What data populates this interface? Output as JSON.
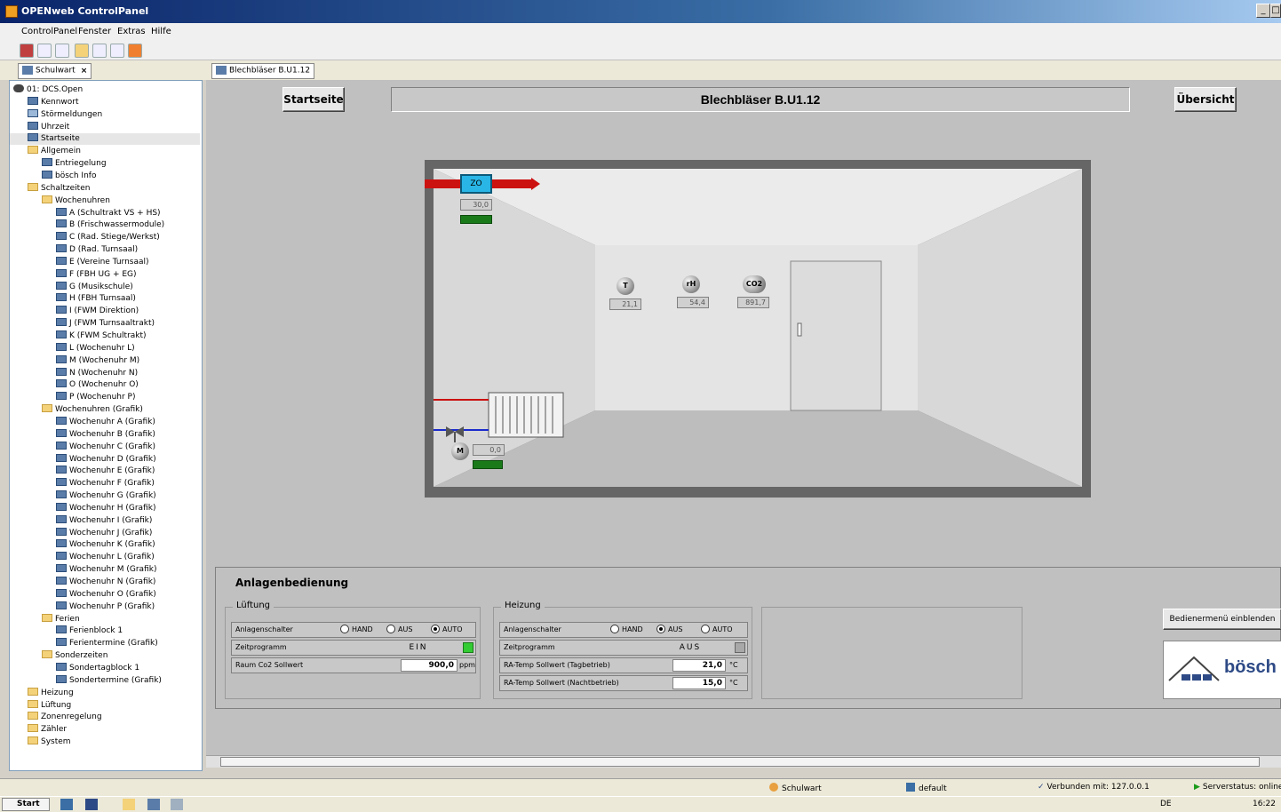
{
  "window": {
    "title": "OPENweb ControlPanel",
    "controls": [
      "_",
      "□"
    ]
  },
  "menubar": [
    "ControlPanel",
    "Fenster",
    "Extras",
    "Hilfe"
  ],
  "left_tab": {
    "label": "Schulwart"
  },
  "tree": [
    {
      "label": "01: DCS.Open",
      "level": 0,
      "icon": "root"
    },
    {
      "label": "Kennwort",
      "level": 1,
      "icon": "doc"
    },
    {
      "label": "Störmeldungen",
      "level": 1,
      "icon": "alarm"
    },
    {
      "label": "Uhrzeit",
      "level": 1,
      "icon": "doc"
    },
    {
      "label": "Startseite",
      "level": 1,
      "icon": "doc",
      "selected": true
    },
    {
      "label": "Allgemein",
      "level": 1,
      "icon": "folder"
    },
    {
      "label": "Entriegelung",
      "level": 2,
      "icon": "doc"
    },
    {
      "label": "bösch Info",
      "level": 2,
      "icon": "doc"
    },
    {
      "label": "Schaltzeiten",
      "level": 1,
      "icon": "folder"
    },
    {
      "label": "Wochenuhren",
      "level": 2,
      "icon": "folder"
    },
    {
      "label": "A (Schultrakt VS + HS)",
      "level": 3,
      "icon": "doc"
    },
    {
      "label": "B (Frischwassermodule)",
      "level": 3,
      "icon": "doc"
    },
    {
      "label": "C (Rad. Stiege/Werkst)",
      "level": 3,
      "icon": "doc"
    },
    {
      "label": "D (Rad. Turnsaal)",
      "level": 3,
      "icon": "doc"
    },
    {
      "label": "E (Vereine Turnsaal)",
      "level": 3,
      "icon": "doc"
    },
    {
      "label": "F (FBH UG + EG)",
      "level": 3,
      "icon": "doc"
    },
    {
      "label": "G (Musikschule)",
      "level": 3,
      "icon": "doc"
    },
    {
      "label": "H (FBH Turnsaal)",
      "level": 3,
      "icon": "doc"
    },
    {
      "label": "I (FWM Direktion)",
      "level": 3,
      "icon": "doc"
    },
    {
      "label": "J (FWM Turnsaaltrakt)",
      "level": 3,
      "icon": "doc"
    },
    {
      "label": "K (FWM Schultrakt)",
      "level": 3,
      "icon": "doc"
    },
    {
      "label": "L (Wochenuhr L)",
      "level": 3,
      "icon": "doc"
    },
    {
      "label": "M (Wochenuhr M)",
      "level": 3,
      "icon": "doc"
    },
    {
      "label": "N (Wochenuhr N)",
      "level": 3,
      "icon": "doc"
    },
    {
      "label": "O (Wochenuhr O)",
      "level": 3,
      "icon": "doc"
    },
    {
      "label": "P (Wochenuhr P)",
      "level": 3,
      "icon": "doc"
    },
    {
      "label": "Wochenuhren (Grafik)",
      "level": 2,
      "icon": "folder"
    },
    {
      "label": "Wochenuhr A (Grafik)",
      "level": 3,
      "icon": "doc"
    },
    {
      "label": "Wochenuhr B (Grafik)",
      "level": 3,
      "icon": "doc"
    },
    {
      "label": "Wochenuhr C (Grafik)",
      "level": 3,
      "icon": "doc"
    },
    {
      "label": "Wochenuhr D (Grafik)",
      "level": 3,
      "icon": "doc"
    },
    {
      "label": "Wochenuhr E (Grafik)",
      "level": 3,
      "icon": "doc"
    },
    {
      "label": "Wochenuhr F (Grafik)",
      "level": 3,
      "icon": "doc"
    },
    {
      "label": "Wochenuhr G (Grafik)",
      "level": 3,
      "icon": "doc"
    },
    {
      "label": "Wochenuhr H (Grafik)",
      "level": 3,
      "icon": "doc"
    },
    {
      "label": "Wochenuhr I (Grafik)",
      "level": 3,
      "icon": "doc"
    },
    {
      "label": "Wochenuhr J (Grafik)",
      "level": 3,
      "icon": "doc"
    },
    {
      "label": "Wochenuhr K (Grafik)",
      "level": 3,
      "icon": "doc"
    },
    {
      "label": "Wochenuhr L (Grafik)",
      "level": 3,
      "icon": "doc"
    },
    {
      "label": "Wochenuhr M (Grafik)",
      "level": 3,
      "icon": "doc"
    },
    {
      "label": "Wochenuhr N (Grafik)",
      "level": 3,
      "icon": "doc"
    },
    {
      "label": "Wochenuhr O (Grafik)",
      "level": 3,
      "icon": "doc"
    },
    {
      "label": "Wochenuhr P (Grafik)",
      "level": 3,
      "icon": "doc"
    },
    {
      "label": "Ferien",
      "level": 2,
      "icon": "folder"
    },
    {
      "label": "Ferienblock 1",
      "level": 3,
      "icon": "doc"
    },
    {
      "label": "Ferientermine (Grafik)",
      "level": 3,
      "icon": "doc"
    },
    {
      "label": "Sonderzeiten",
      "level": 2,
      "icon": "folder"
    },
    {
      "label": "Sondertagblock 1",
      "level": 3,
      "icon": "doc"
    },
    {
      "label": "Sondertermine (Grafik)",
      "level": 3,
      "icon": "doc"
    },
    {
      "label": "Heizung",
      "level": 1,
      "icon": "folder"
    },
    {
      "label": "Lüftung",
      "level": 1,
      "icon": "folder"
    },
    {
      "label": "Zonenregelung",
      "level": 1,
      "icon": "folder"
    },
    {
      "label": "Zähler",
      "level": 1,
      "icon": "folder"
    },
    {
      "label": "System",
      "level": 1,
      "icon": "folder"
    }
  ],
  "right_tab": {
    "label": "Blechbläser B.U1.12"
  },
  "header": {
    "start_button": "Startseite",
    "title": "Blechbläser B.U1.12",
    "overview_button": "Übersicht"
  },
  "room": {
    "fan_label": "ZO",
    "supply_value": "30,0",
    "sensors": [
      {
        "symbol": "T",
        "value": "21,1"
      },
      {
        "symbol": "rH",
        "value": "54,4"
      },
      {
        "symbol": "CO2",
        "value": "891,7"
      }
    ],
    "valve_motor": "M",
    "valve_value": "0,0"
  },
  "panel": {
    "title": "Anlagenbedienung",
    "lueftung": {
      "label": "Lüftung",
      "switch_label": "Anlagenschalter",
      "options": [
        "HAND",
        "AUS",
        "AUTO"
      ],
      "selected": "AUTO",
      "program_label": "Zeitprogramm",
      "program_state": "EIN",
      "co2_label": "Raum Co2 Sollwert",
      "co2_value": "900,0",
      "co2_unit": "ppm"
    },
    "heizung": {
      "label": "Heizung",
      "switch_label": "Anlagenschalter",
      "options": [
        "HAND",
        "AUS",
        "AUTO"
      ],
      "selected": "AUS",
      "program_label": "Zeitprogramm",
      "program_state": "AUS",
      "day_label": "RA-Temp Sollwert (Tagbetrieb)",
      "day_value": "21,0",
      "night_label": "RA-Temp Sollwert (Nachtbetrieb)",
      "night_value": "15,0",
      "unit": "°C"
    },
    "menu_button": "Bedienermenü einblenden",
    "logo_text": "bösch"
  },
  "statusbar": {
    "user": "Schulwart",
    "profile": "default",
    "connection": "Verbunden mit: 127.0.0.1",
    "server": "Serverstatus: online"
  },
  "taskbar": {
    "start": "Start",
    "lang": "DE",
    "time": "16:22"
  },
  "colors": {
    "accent_red": "#cc1111",
    "indicator_green": "#1a7a1a",
    "fan_cyan": "#29b6e6"
  }
}
